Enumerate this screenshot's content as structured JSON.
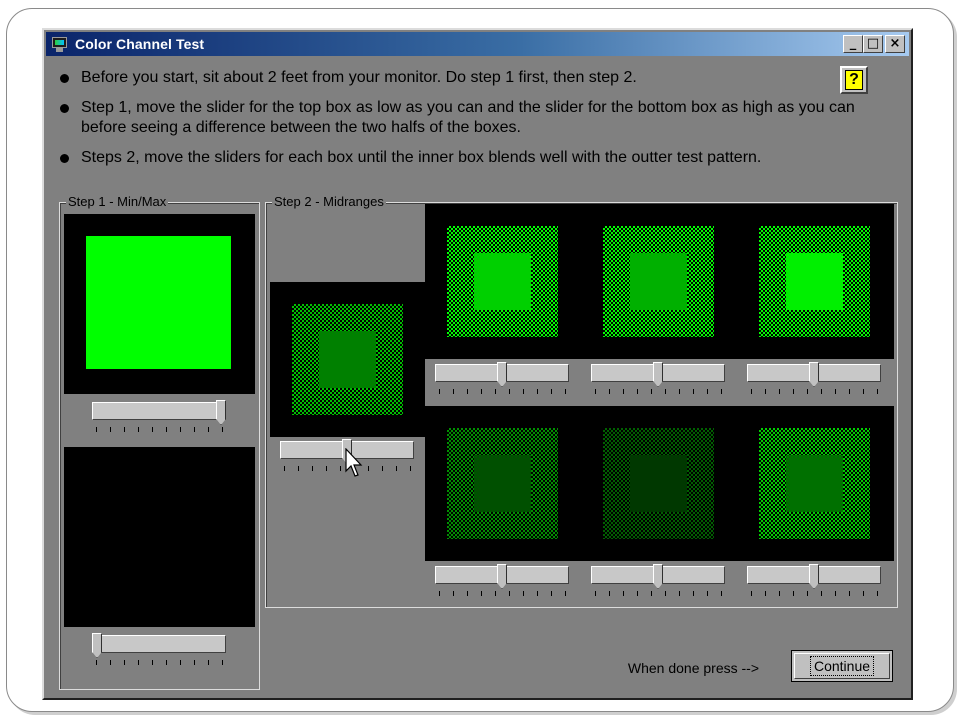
{
  "window": {
    "title": "Color Channel Test",
    "buttons": {
      "minimize": "_",
      "maximize": "□",
      "close": "×"
    }
  },
  "instructions": [
    "Before you start, sit about 2 feet from your monitor.  Do step 1 first, then step 2.",
    "Step 1, move the slider for the top box as low as you can and the slider for the bottom box as high as you can before seeing a difference between the two halfs of the boxes.",
    "Steps 2, move the sliders for each box until the inner box blends well with the outter test pattern."
  ],
  "help_button": {
    "label": "?"
  },
  "step1": {
    "label": "Step 1 - Min/Max",
    "top_box": {
      "outer_color": "#00ff00",
      "inner_color": "#00ff00",
      "slider_value": 1.0
    },
    "bottom_box": {
      "outer_color": "#000000",
      "inner_color": "#000000",
      "slider_value": 0.0
    }
  },
  "step2": {
    "label": "Step 2 - Midranges",
    "left_box": {
      "pattern_color": "#00c000",
      "inner_color": "#008000",
      "slider_value": 0.5
    },
    "top_row": [
      {
        "pattern_color": "#00ff00",
        "inner_color": "#00d000",
        "slider_value": 0.5
      },
      {
        "pattern_color": "#00ff00",
        "inner_color": "#00b000",
        "slider_value": 0.5
      },
      {
        "pattern_color": "#00ff00",
        "inner_color": "#00f000",
        "slider_value": 0.5
      }
    ],
    "bottom_row": [
      {
        "pattern_color": "#009000",
        "inner_color": "#005000",
        "slider_value": 0.5
      },
      {
        "pattern_color": "#006000",
        "inner_color": "#003800",
        "slider_value": 0.5
      },
      {
        "pattern_color": "#00d000",
        "inner_color": "#007000",
        "slider_value": 0.5
      }
    ]
  },
  "footer": {
    "status_text": "When done press -->",
    "continue_label": "Continue"
  }
}
